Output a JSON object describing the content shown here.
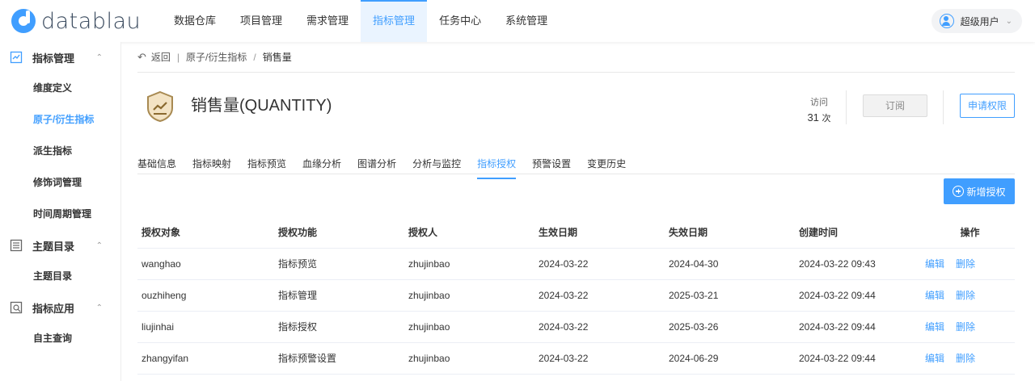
{
  "app": {
    "logo_text": "datablau"
  },
  "topnav": [
    {
      "label": "数据仓库",
      "active": false
    },
    {
      "label": "项目管理",
      "active": false
    },
    {
      "label": "需求管理",
      "active": false
    },
    {
      "label": "指标管理",
      "active": true
    },
    {
      "label": "任务中心",
      "active": false
    },
    {
      "label": "系统管理",
      "active": false
    }
  ],
  "user": {
    "name": "超级用户"
  },
  "sidebar": {
    "groups": [
      {
        "label": "指标管理",
        "icon": "metrics-icon",
        "items": [
          "维度定义",
          "原子/衍生指标",
          "派生指标",
          "修饰词管理",
          "时间周期管理"
        ]
      },
      {
        "label": "主题目录",
        "icon": "catalog-icon",
        "items": [
          "主题目录"
        ]
      },
      {
        "label": "指标应用",
        "icon": "application-icon",
        "items": [
          "自主查询"
        ]
      }
    ],
    "active_item": "原子/衍生指标"
  },
  "breadcrumb": {
    "back": "返回",
    "parent": "原子/衍生指标",
    "current": "销售量"
  },
  "header": {
    "title": "销售量(QUANTITY)",
    "visits_label": "访问",
    "visits_count": "31",
    "visits_unit": "次",
    "subscribe_label": "订阅",
    "apply_label": "申请权限"
  },
  "tabs": [
    "基础信息",
    "指标映射",
    "指标预览",
    "血缘分析",
    "图谱分析",
    "分析与监控",
    "指标授权",
    "预警设置",
    "变更历史"
  ],
  "active_tab": "指标授权",
  "add_button": "新增授权",
  "table": {
    "columns": [
      "授权对象",
      "授权功能",
      "授权人",
      "生效日期",
      "失效日期",
      "创建时间",
      "操作"
    ],
    "rows": [
      [
        "wanghao",
        "指标预览",
        "zhujinbao",
        "2024-03-22",
        "2024-04-30",
        "2024-03-22 09:43"
      ],
      [
        "ouzhiheng",
        "指标管理",
        "zhujinbao",
        "2024-03-22",
        "2025-03-21",
        "2024-03-22 09:44"
      ],
      [
        "liujinhai",
        "指标授权",
        "zhujinbao",
        "2024-03-22",
        "2025-03-26",
        "2024-03-22 09:44"
      ],
      [
        "zhangyifan",
        "指标预警设置",
        "zhujinbao",
        "2024-03-22",
        "2024-06-29",
        "2024-03-22 09:44"
      ]
    ],
    "edit_label": "编辑",
    "delete_label": "删除"
  },
  "colors": {
    "accent": "#409eff"
  }
}
